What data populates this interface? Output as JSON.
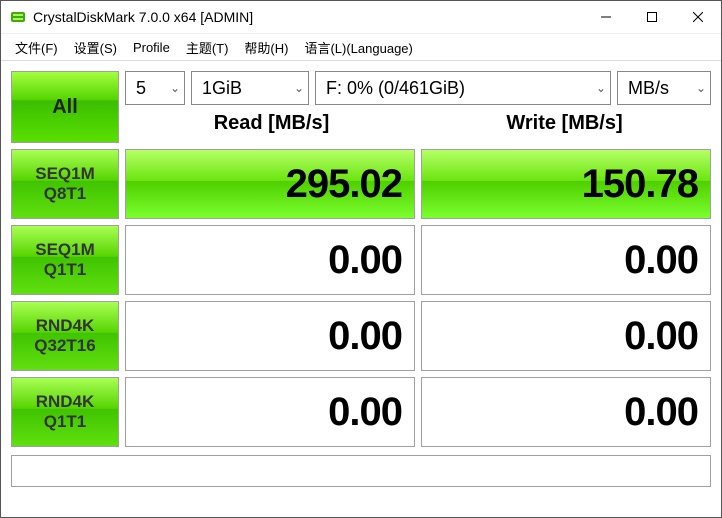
{
  "title": "CrystalDiskMark 7.0.0 x64 [ADMIN]",
  "menu": {
    "file": "文件(F)",
    "settings": "设置(S)",
    "profile": "Profile",
    "theme": "主题(T)",
    "help": "帮助(H)",
    "language": "语言(L)(Language)"
  },
  "controls": {
    "all": "All",
    "loops": "5",
    "size": "1GiB",
    "drive": "F: 0% (0/461GiB)",
    "unit": "MB/s"
  },
  "headers": {
    "read": "Read [MB/s]",
    "write": "Write [MB/s]"
  },
  "tests": [
    {
      "l1": "SEQ1M",
      "l2": "Q8T1",
      "read": "295.02",
      "write": "150.78",
      "highlight": true
    },
    {
      "l1": "SEQ1M",
      "l2": "Q1T1",
      "read": "0.00",
      "write": "0.00",
      "highlight": false
    },
    {
      "l1": "RND4K",
      "l2": "Q32T16",
      "read": "0.00",
      "write": "0.00",
      "highlight": false
    },
    {
      "l1": "RND4K",
      "l2": "Q1T1",
      "read": "0.00",
      "write": "0.00",
      "highlight": false
    }
  ],
  "chart_data": {
    "type": "table",
    "title": "CrystalDiskMark 7.0.0 results — F: 0% (0/461GiB), 1GiB, 5 loops",
    "columns": [
      "Test",
      "Read MB/s",
      "Write MB/s"
    ],
    "rows": [
      [
        "SEQ1M Q8T1",
        295.02,
        150.78
      ],
      [
        "SEQ1M Q1T1",
        0.0,
        0.0
      ],
      [
        "RND4K Q32T16",
        0.0,
        0.0
      ],
      [
        "RND4K Q1T1",
        0.0,
        0.0
      ]
    ]
  }
}
